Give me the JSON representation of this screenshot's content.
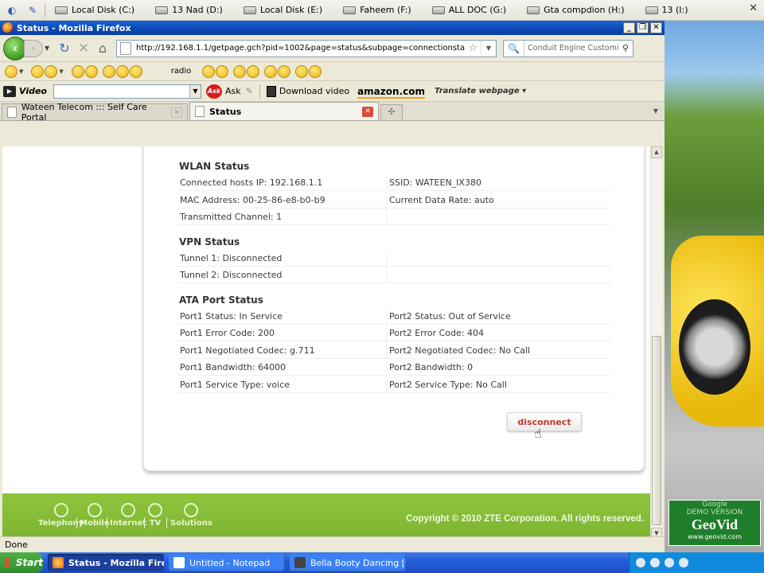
{
  "quicklaunch": {
    "drives": [
      "Local Disk (C:)",
      "13 Nad (D:)",
      "Local Disk (E:)",
      "Faheem  (F:)",
      "ALL DOC (G:)",
      "Gta compdion (H:)",
      "13 (I:)"
    ],
    "close_icon": "close-icon"
  },
  "window": {
    "title": "Status - Mozilla Firefox",
    "minimize": "_",
    "maximize": "❐",
    "close": "✕"
  },
  "nav": {
    "url": "http://192.168.1.1/getpage.gch?pid=1002&page=status&subpage=connectionstatus",
    "search_placeholder": "Conduit Engine Customiz"
  },
  "iconbar": {
    "radio_label": "radio"
  },
  "toolbar2": {
    "video_label": "Video",
    "ask_label": "Ask",
    "ask_logo": "Ask",
    "download_label": "Download video",
    "amazon_label": "amazon.com",
    "translate_label": "Translate webpage"
  },
  "tabs": [
    {
      "label": "Wateen Telecom ::: Self Care Portal",
      "active": false
    },
    {
      "label": "Status",
      "active": true
    }
  ],
  "status_page": {
    "wlan": {
      "title": "WLAN Status",
      "rows": [
        [
          "Connected hosts IP:  192.168.1.1",
          "SSID:  WATEEN_IX380"
        ],
        [
          "MAC Address:  00-25-86-e8-b0-b9",
          "Current Data Rate:  auto"
        ],
        [
          "Transmitted Channel:  1",
          ""
        ]
      ]
    },
    "vpn": {
      "title": "VPN Status",
      "rows": [
        [
          "Tunnel 1:  Disconnected",
          ""
        ],
        [
          "Tunnel 2:  Disconnected",
          ""
        ]
      ]
    },
    "ata": {
      "title": "ATA Port Status",
      "rows": [
        [
          "Port1 Status:  In Service",
          "Port2 Status:  Out of Service"
        ],
        [
          "Port1 Error Code:  200",
          "Port2 Error Code:  404"
        ],
        [
          "Port1 Negotiated Codec:  g.711",
          "Port2 Negotiated Codec:  No Call"
        ],
        [
          "Port1 Bandwidth:  64000",
          "Port2 Bandwidth:  0"
        ],
        [
          "Port1 Service Type:  voice",
          "Port2 Service Type:  No Call"
        ]
      ]
    },
    "disconnect_label": "disconnect"
  },
  "footer": {
    "items": [
      "Telephony",
      "Mobile",
      "Internet",
      "TV",
      "Solutions"
    ],
    "copyright": "Copyright © 2010 ZTE Corporation. All rights reserved."
  },
  "statusbar": {
    "text": "Done"
  },
  "desktop": {
    "watermark_top": "Google",
    "watermark_demo": "DEMO VERSION",
    "watermark_brand": "GeoVid",
    "watermark_url": "www.geovid.com"
  },
  "taskbar": {
    "start_label": "Start",
    "tasks": [
      {
        "label": "Status - Mozilla Firefox",
        "active": true
      },
      {
        "label": "Untitled - Notepad",
        "active": false
      },
      {
        "label": "Bella Booty Dancing [ww...",
        "active": false
      }
    ]
  },
  "colors": {
    "footer_green": "#8ec43d",
    "disconnect_red": "#c0392b",
    "titlebar_blue": "#0a47b3"
  }
}
